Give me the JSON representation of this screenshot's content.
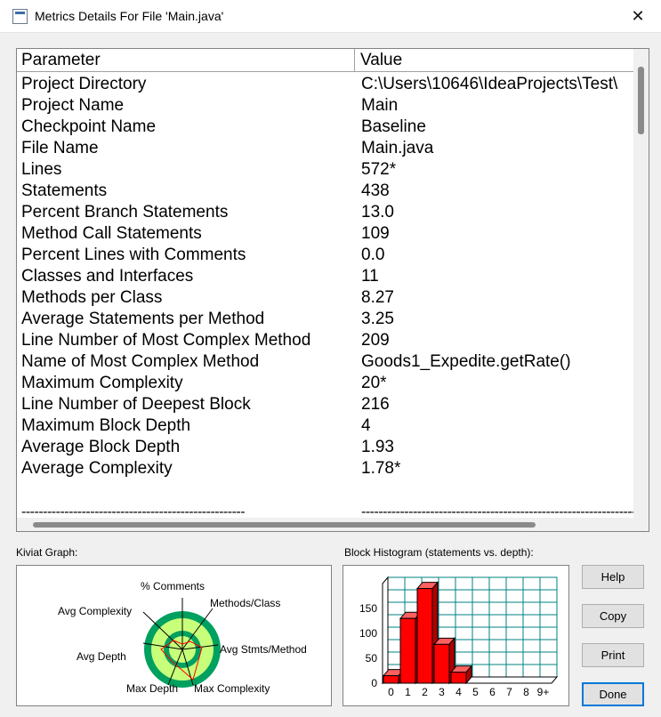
{
  "window": {
    "title": "Metrics Details For File 'Main.java'",
    "close_glyph": "✕"
  },
  "table": {
    "columns": [
      "Parameter",
      "Value"
    ],
    "rows": [
      [
        "Project Directory",
        "C:\\Users\\10646\\IdeaProjects\\Test\\"
      ],
      [
        "Project Name",
        "Main"
      ],
      [
        "Checkpoint Name",
        "Baseline"
      ],
      [
        "File Name",
        "Main.java"
      ],
      [
        "Lines",
        "572*"
      ],
      [
        "Statements",
        "438"
      ],
      [
        "Percent Branch Statements",
        "13.0"
      ],
      [
        "Method Call Statements",
        "109"
      ],
      [
        "Percent Lines with Comments",
        "0.0"
      ],
      [
        "Classes and Interfaces",
        "11"
      ],
      [
        "Methods per Class",
        "8.27"
      ],
      [
        "Average Statements per Method",
        "3.25"
      ],
      [
        "Line Number of Most Complex Method",
        "209"
      ],
      [
        "Name of Most Complex Method",
        "Goods1_Expedite.getRate()"
      ],
      [
        "Maximum Complexity",
        "20*"
      ],
      [
        "Line Number of Deepest Block",
        "216"
      ],
      [
        "Maximum Block Depth",
        "4"
      ],
      [
        "Average Block Depth",
        "1.93"
      ],
      [
        "Average Complexity",
        "1.78*"
      ]
    ],
    "separator_left": "----------------------------------------------------",
    "separator_right": "----------------------------------------------------------------"
  },
  "kiviat": {
    "label": "Kiviat Graph:",
    "axes": [
      "% Comments",
      "Methods/Class",
      "Avg Stmts/Method",
      "Max Complexity",
      "Max Depth",
      "Avg Depth",
      "Avg Complexity"
    ]
  },
  "histogram": {
    "label": "Block Histogram (statements vs. depth):"
  },
  "buttons": {
    "help": "Help",
    "copy": "Copy",
    "print": "Print",
    "done": "Done"
  },
  "colors": {
    "bar": "#ff0000",
    "grid_back": "#008080",
    "kiviat_band": "#c8ff7a",
    "kiviat_ring": "#00a060"
  },
  "chart_data": {
    "type": "bar",
    "categories": [
      "0",
      "1",
      "2",
      "3",
      "4",
      "5",
      "6",
      "7",
      "8",
      "9+"
    ],
    "values": [
      15,
      130,
      190,
      78,
      22,
      0,
      0,
      0,
      0,
      0
    ],
    "yticks": [
      "0",
      "50",
      "100",
      "150"
    ],
    "ylim": [
      0,
      200
    ],
    "xlabel": "",
    "ylabel": "",
    "title": ""
  }
}
